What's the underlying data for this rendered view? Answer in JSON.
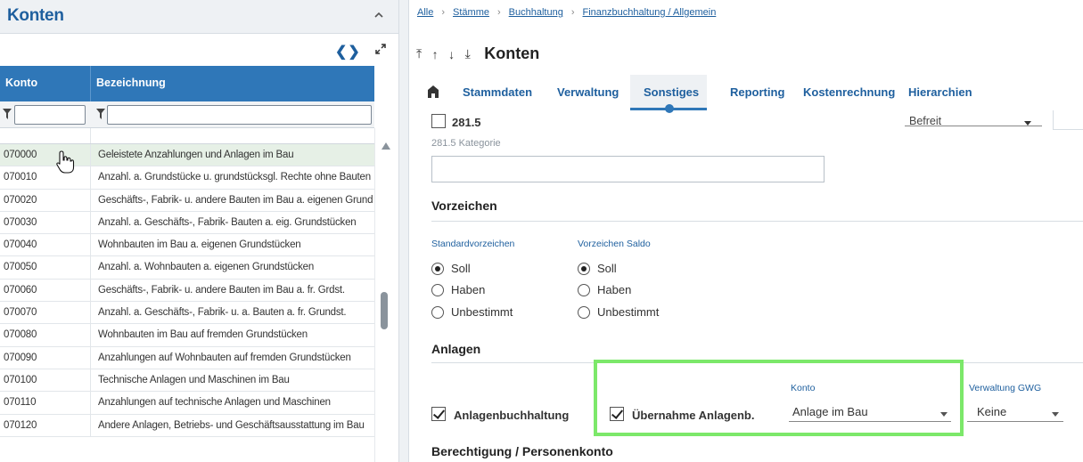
{
  "left_panel": {
    "title": "Konten",
    "nav_icons": "❮❯",
    "columns": {
      "konto": "Konto",
      "bezeichnung": "Bezeichnung"
    },
    "rows": [
      {
        "konto": "070000",
        "bez": "Geleistete Anzahlungen und Anlagen im Bau"
      },
      {
        "konto": "070010",
        "bez": "Anzahl. a. Grundstücke u. grundstücksgl. Rechte ohne Bauten"
      },
      {
        "konto": "070020",
        "bez": "Geschäfts-, Fabrik- u. andere Bauten im Bau a. eigenen Grund"
      },
      {
        "konto": "070030",
        "bez": "Anzahl. a. Geschäfts-, Fabrik- Bauten a. eig. Grundstücken"
      },
      {
        "konto": "070040",
        "bez": "Wohnbauten im Bau a. eigenen Grundstücken"
      },
      {
        "konto": "070050",
        "bez": "Anzahl. a. Wohnbauten a. eigenen Grundstücken"
      },
      {
        "konto": "070060",
        "bez": "Geschäfts-, Fabrik- u. andere Bauten im Bau a. fr. Grdst."
      },
      {
        "konto": "070070",
        "bez": "Anzahl. a. Geschäfts-, Fabrik- u. a. Bauten a. fr. Grundst."
      },
      {
        "konto": "070080",
        "bez": "Wohnbauten im Bau auf fremden Grundstücken"
      },
      {
        "konto": "070090",
        "bez": "Anzahlungen auf Wohnbauten auf fremden Grundstücken"
      },
      {
        "konto": "070100",
        "bez": "Technische Anlagen und Maschinen im Bau"
      },
      {
        "konto": "070110",
        "bez": "Anzahlungen auf technische Anlagen und Maschinen"
      },
      {
        "konto": "070120",
        "bez": "Andere Anlagen, Betriebs- und Geschäftsausstattung im Bau"
      }
    ]
  },
  "breadcrumb": [
    "Alle",
    "Stämme",
    "Buchhaltung",
    "Finanzbuchhaltung / Allgemein"
  ],
  "breadcrumb_sep": "›",
  "title_row": {
    "arrows": [
      "⤒",
      "↑",
      "↓",
      "⤓"
    ],
    "title": "Konten"
  },
  "tabs": [
    "Stammdaten",
    "Verwaltung",
    "Sonstiges",
    "Reporting",
    "Kostenrechnung",
    "Hierarchien"
  ],
  "active_tab": "Sonstiges",
  "form": {
    "field_2815_label": "281.5",
    "befreit_value": "Befreit",
    "kategorie_label": "281.5 Kategorie",
    "kategorie_value": "",
    "vorzeichen": {
      "title": "Vorzeichen",
      "standard_label": "Standardvorzeichen",
      "saldo_label": "Vorzeichen Saldo",
      "options": [
        "Soll",
        "Haben",
        "Unbestimmt"
      ],
      "standard_selected": "Soll",
      "saldo_selected": "Soll"
    },
    "anlagen": {
      "title": "Anlagen",
      "anlagenbuchhaltung_label": "Anlagenbuchhaltung",
      "anlagenbuchhaltung_checked": true,
      "uebernahme_label": "Übernahme Anlagenb.",
      "uebernahme_checked": true,
      "konto_label": "Konto",
      "konto_value": "Anlage im Bau",
      "gwg_label": "Verwaltung GWG",
      "gwg_value": "Keine"
    },
    "berechtigung_title": "Berechtigung / Personenkonto"
  },
  "colors": {
    "accent": "#1e5f9e",
    "header_blue": "#2f77b8",
    "highlight_green": "#7ce86a"
  }
}
